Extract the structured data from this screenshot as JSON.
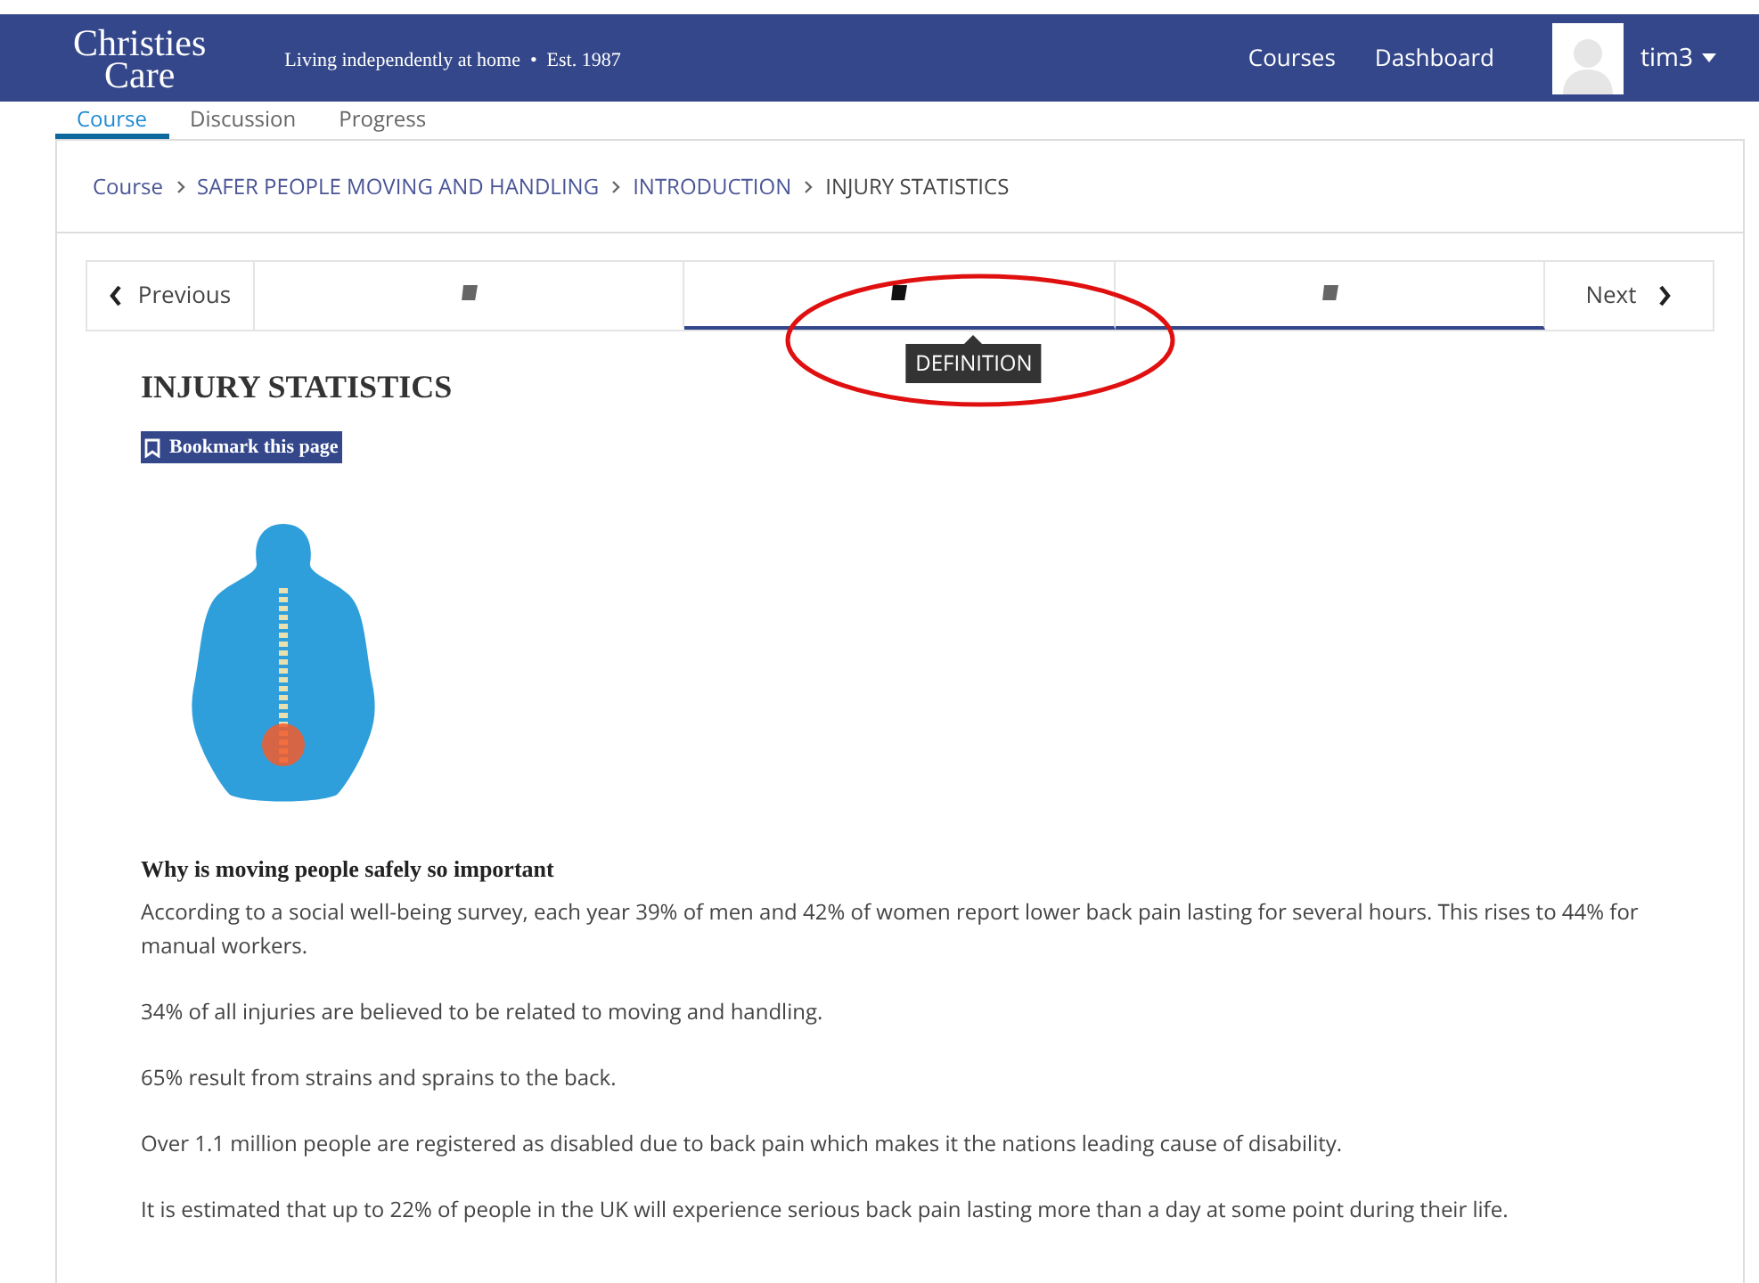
{
  "header": {
    "logo_line1": "Christies",
    "logo_line2": "Care",
    "tagline": "Living independently at home  •  Est. 1987",
    "nav": [
      "Courses",
      "Dashboard"
    ],
    "username": "tim3"
  },
  "course_tabs": [
    {
      "label": "Course",
      "selected": true
    },
    {
      "label": "Discussion",
      "selected": false
    },
    {
      "label": "Progress",
      "selected": false
    }
  ],
  "breadcrumb": [
    "Course",
    "SAFER PEOPLE MOVING AND HANDLING",
    "INTRODUCTION",
    "INJURY STATISTICS"
  ],
  "unit_nav": {
    "previous": "Previous",
    "next": "Next",
    "units": [
      {
        "selected": false,
        "complete": false
      },
      {
        "selected": true,
        "complete": true
      },
      {
        "selected": false,
        "complete": true
      }
    ],
    "tooltip": "DEFINITION"
  },
  "title": "INJURY STATISTICS",
  "bookmark": "Bookmark this page",
  "subheading": "Why is moving people safely so important",
  "paragraphs": [
    "According to a social well-being survey, each year 39% of men and 42% of women report lower back pain lasting for several hours. This rises to 44% for manual workers.",
    "34% of all injuries are believed to be related to moving and handling.",
    "65% result from strains and sprains to the back.",
    "Over 1.1 million people are registered as disabled due to back pain which makes it the nations leading cause of disability.",
    "It is estimated that up to 22% of people in the UK will experience serious back pain lasting more than a day at some point during their life."
  ]
}
